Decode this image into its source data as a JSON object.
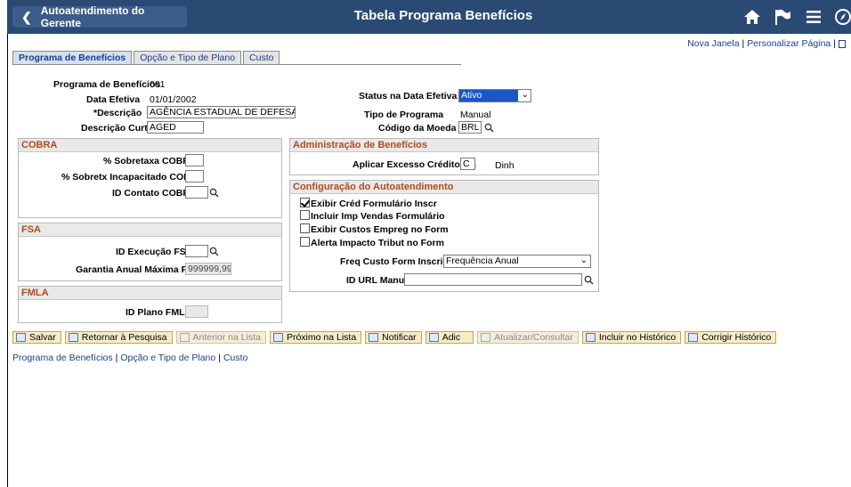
{
  "header": {
    "back_label": "Autoatendimento do Gerente",
    "title": "Tabela Programa Benefícios"
  },
  "toplinks": {
    "new_window": "Nova Janela",
    "personalize": "Personalizar Página"
  },
  "tabs": [
    {
      "label": "Programa de Benefícios",
      "active": true
    },
    {
      "label": "Opção e Tipo de Plano",
      "active": false
    },
    {
      "label": "Custo",
      "active": false
    }
  ],
  "form": {
    "program_label": "Programa de Benefícios",
    "program_value": "001",
    "eff_date_label": "Data Efetiva",
    "eff_date_value": "01/01/2002",
    "desc_label": "*Descrição",
    "desc_value": "AGÊNCIA ESTADUAL DE DEFESA AGR",
    "short_desc_label": "Descrição Curta",
    "short_desc_value": "AGED",
    "status_label": "Status na Data Efetiva",
    "status_value": "Ativo",
    "type_label": "Tipo de Programa",
    "type_value": "Manual",
    "currency_label": "Código da Moeda",
    "currency_value": "BRL"
  },
  "cobra": {
    "title": "COBRA",
    "surcharge_label": "% Sobretaxa COBRA",
    "surcharge_value": "",
    "disabled_label": "% Sobretx Incapacitado COBRA",
    "disabled_value": "",
    "contact_label": "ID Contato COBRA",
    "contact_value": ""
  },
  "fsa": {
    "title": "FSA",
    "exec_label": "ID Execução FSA",
    "exec_value": "",
    "max_label": "Garantia Anual Máxima FSA",
    "max_value": "999999,99"
  },
  "fmla": {
    "title": "FMLA",
    "plan_label": "ID Plano FMLA",
    "plan_value": ""
  },
  "admin": {
    "title": "Administração de Benefícios",
    "excess_label": "Aplicar Excesso Crédito em",
    "excess_value": "C",
    "excess_desc": "Dinh"
  },
  "selfservice": {
    "title": "Configuração do Autoatendimento",
    "checkboxes": [
      {
        "label": "Exibir Créd Formulário Inscr",
        "checked": true
      },
      {
        "label": "Incluir Imp Vendas Formulário",
        "checked": false
      },
      {
        "label": "Exibir Custos Empreg no Form",
        "checked": false
      },
      {
        "label": "Alerta Impacto Tribut no Form",
        "checked": false
      }
    ],
    "freq_label": "Freq Custo Form Inscrição",
    "freq_value": "Frequência Anual",
    "url_label": "ID URL Manual",
    "url_value": ""
  },
  "toolbar": {
    "save": "Salvar",
    "return": "Retornar à Pesquisa",
    "prev": "Anterior na Lista",
    "next": "Próximo na Lista",
    "notify": "Notificar",
    "add": "Adic",
    "update": "Atualizar/Consultar",
    "include_history": "Incluir no Histórico",
    "correct_history": "Corrigir Histórico"
  },
  "bottomlinks": [
    "Programa de Benefícios",
    "Opção e Tipo de Plano",
    "Custo"
  ],
  "colors": {
    "header": "#2a4a74",
    "group_title": "#b04a1e",
    "link": "#1a3f8a",
    "status_select": "#1a56c8"
  }
}
